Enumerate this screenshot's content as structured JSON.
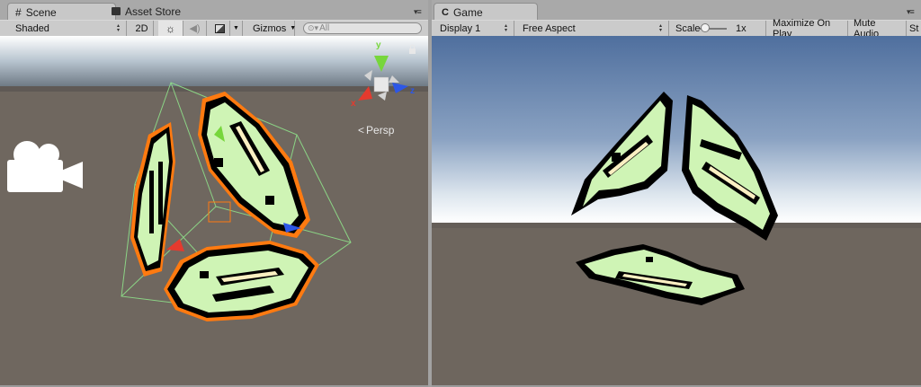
{
  "scene": {
    "tabs": [
      {
        "label": "Scene",
        "icon": "grid-icon",
        "active": true
      },
      {
        "label": "Asset Store",
        "icon": "store-icon",
        "active": false
      }
    ],
    "toolbar": {
      "shading_mode": "Shaded",
      "mode_2d": "2D",
      "gizmos": "Gizmos",
      "search_placeholder": "All"
    },
    "gizmo_axes": {
      "x": "x",
      "y": "y",
      "z": "z"
    },
    "projection_label": "Persp"
  },
  "game": {
    "tab": {
      "label": "Game",
      "icon": "game-icon"
    },
    "toolbar": {
      "display": "Display 1",
      "aspect": "Free Aspect",
      "scale_label": "Scale",
      "scale_value": "1x",
      "scale_level": 0.1,
      "maximize_on_play": "Maximize On Play",
      "mute_audio": "Mute Audio",
      "stats_cut": "St"
    }
  },
  "colors": {
    "pixel_face": "#cff4b5",
    "pixel_outline": "#000000",
    "pixel_accent": "#fbf0c2",
    "selection_outline": "#ff7a10",
    "bounds": "#8fe08a",
    "axis_x": "#e43a2e",
    "axis_y": "#77d63c",
    "axis_z": "#2d57e6"
  }
}
